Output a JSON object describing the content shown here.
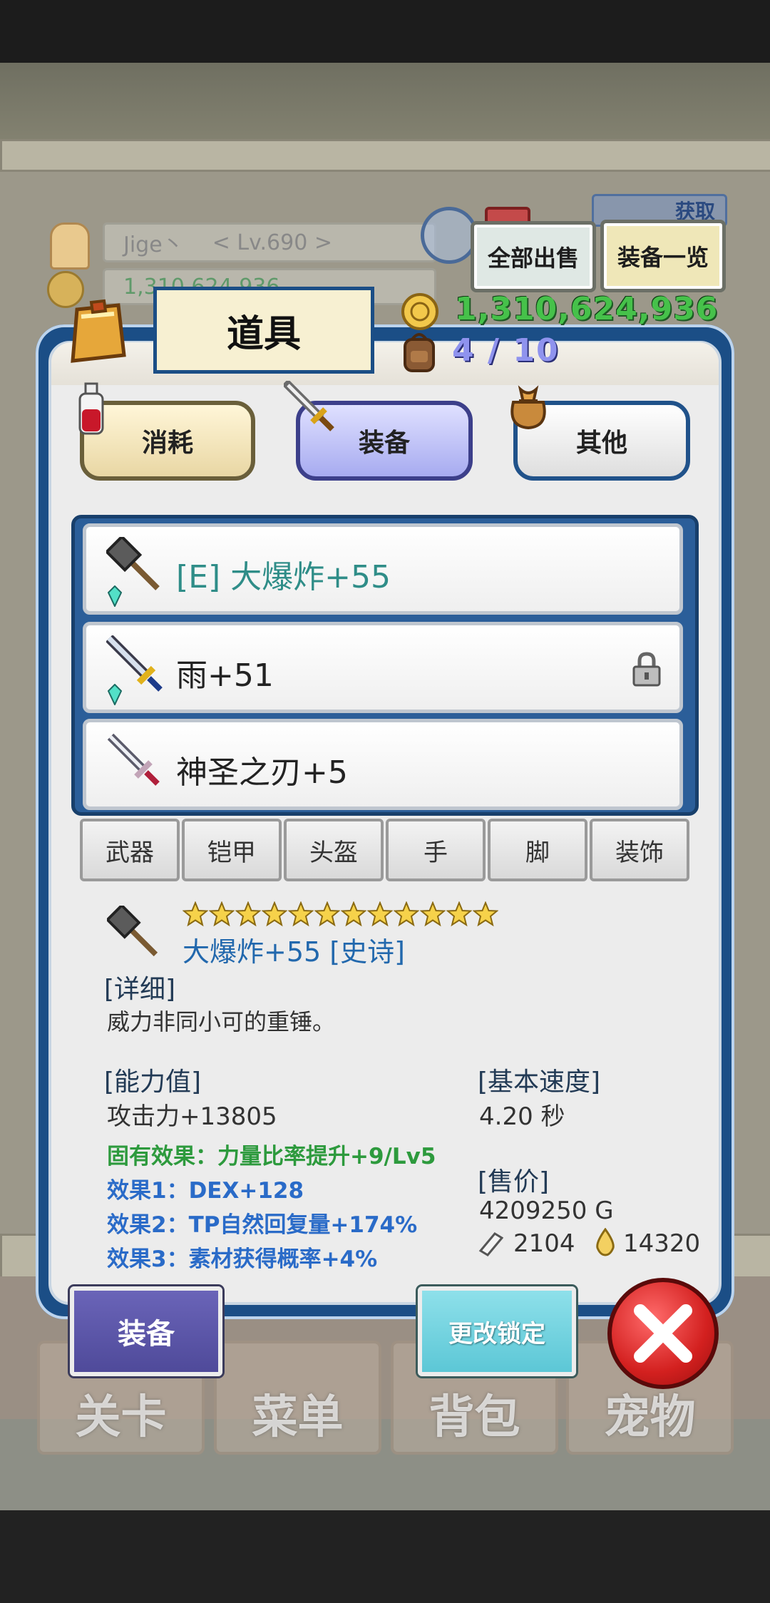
{
  "background": {
    "player_name": "Jige丶",
    "player_level": "< Lv.690 >",
    "gold_faded": "1,310,624,936",
    "obtain_label": "获取",
    "nav": [
      "关卡",
      "菜单",
      "背包",
      "宠物"
    ]
  },
  "top_buttons": {
    "sell_all": "全部出售",
    "equip_list": "装备一览"
  },
  "panel": {
    "title": "道具",
    "money": "1,310,624,936",
    "slots": "4 / 10",
    "tabs": {
      "consume": "消耗",
      "equip": "装备",
      "other": "其他"
    }
  },
  "items": [
    {
      "name": "[E] 大爆炸+55",
      "equipped": true,
      "locked": false,
      "icon": "hammer-icon",
      "gem": true,
      "color": "#2f8d88"
    },
    {
      "name": "雨+51",
      "equipped": false,
      "locked": true,
      "icon": "sword-icon",
      "gem": true,
      "color": "#222222"
    },
    {
      "name": "神圣之刃+5",
      "equipped": false,
      "locked": false,
      "icon": "holy-blade-icon",
      "gem": false,
      "color": "#222222"
    }
  ],
  "filters": [
    "武器",
    "铠甲",
    "头盔",
    "手",
    "脚",
    "装饰"
  ],
  "detail": {
    "stars": 12,
    "item_title": "大爆炸+55 [史诗]",
    "detail_heading": "[详细]",
    "description": "威力非同小可的重锤。",
    "stats_heading": "[能力值]",
    "attack": "攻击力+13805",
    "inherent": "固有效果：力量比率提升+9/Lv5",
    "effect1": "效果1：DEX+128",
    "effect2": "效果2：TP自然回复量+174%",
    "effect3": "效果3：素材获得概率+4%",
    "speed_heading": "[基本速度]",
    "speed": "4.20 秒",
    "price_heading": "[售价]",
    "price": "4209250 G",
    "material1": "2104",
    "material2": "14320"
  },
  "bottom_buttons": {
    "equip": "装备",
    "change_lock": "更改锁定"
  }
}
